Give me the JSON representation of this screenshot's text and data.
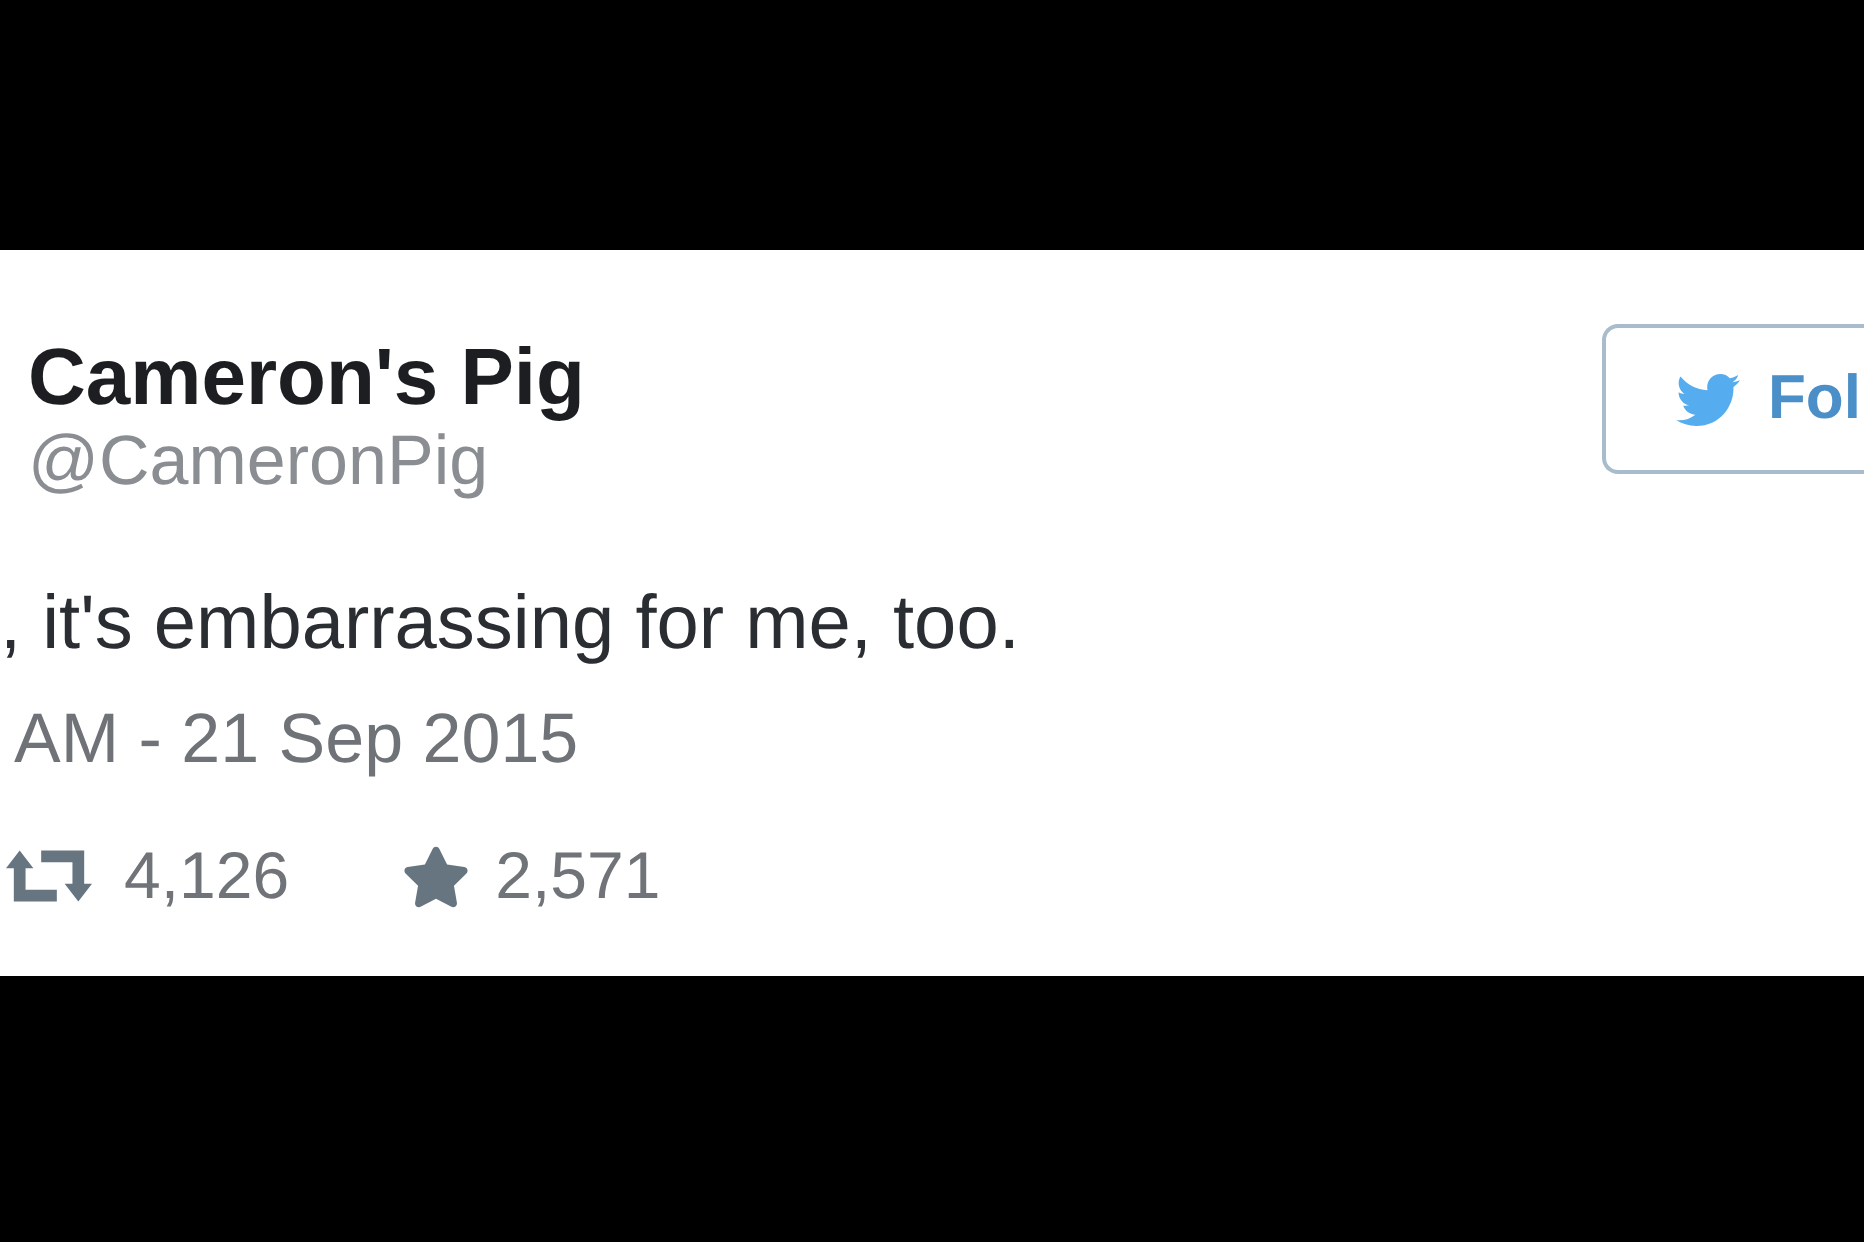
{
  "tweet": {
    "author_name": "Cameron's Pig",
    "handle": "@CameronPig",
    "follow_button": {
      "label": "Fol"
    },
    "text": ", it's embarrassing for me, too.",
    "timestamp": "AM - 21 Sep 2015",
    "stats": [
      {
        "kind": "retweets",
        "count": "4,126"
      },
      {
        "kind": "favorites",
        "count": "2,571"
      }
    ]
  }
}
